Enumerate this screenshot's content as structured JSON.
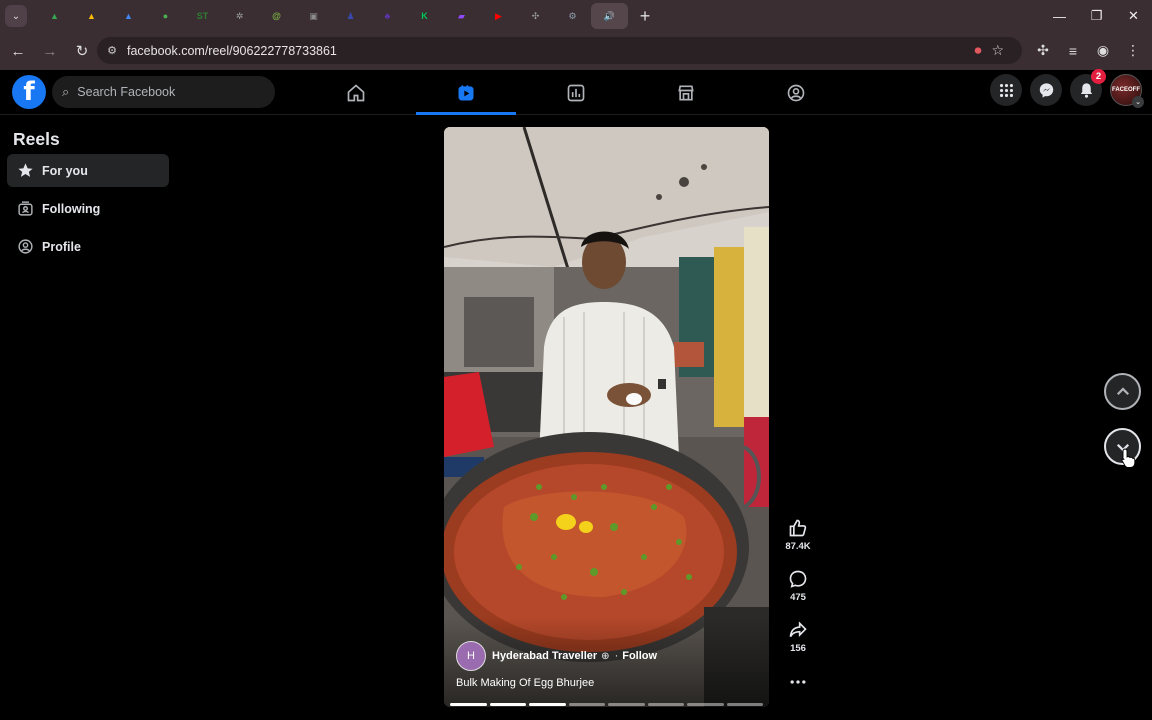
{
  "browser": {
    "url": "facebook.com/reel/906222778733861",
    "tab_favicons": [
      {
        "name": "drive-icon",
        "color": "#34a853",
        "glyph": "▲"
      },
      {
        "name": "drive-icon",
        "color": "#fbbc04",
        "glyph": "▲"
      },
      {
        "name": "drive-icon",
        "color": "#4285f4",
        "glyph": "▲"
      },
      {
        "name": "green-leaf-icon",
        "color": "#4caf50",
        "glyph": "●"
      },
      {
        "name": "st-icon",
        "color": "#2e7d32",
        "glyph": "ST"
      },
      {
        "name": "openai-icon",
        "color": "#9e9e9e",
        "glyph": "✲"
      },
      {
        "name": "at-icon",
        "color": "#7cb342",
        "glyph": "@"
      },
      {
        "name": "image-icon",
        "color": "#8d8d8d",
        "glyph": "▣"
      },
      {
        "name": "blue-icon",
        "color": "#3949ab",
        "glyph": "♟"
      },
      {
        "name": "purple-icon",
        "color": "#5e35b1",
        "glyph": "♣"
      },
      {
        "name": "k-icon",
        "color": "#00c853",
        "glyph": "K"
      },
      {
        "name": "twitch-icon",
        "color": "#9146ff",
        "glyph": "▰"
      },
      {
        "name": "youtube-icon",
        "color": "#ff0000",
        "glyph": "▶"
      },
      {
        "name": "puzzle-icon",
        "color": "#9e9e9e",
        "glyph": "✣"
      },
      {
        "name": "tool-icon",
        "color": "#90a4ae",
        "glyph": "⚙"
      },
      {
        "name": "audio-icon",
        "color": "#bbbbbb",
        "glyph": "🔊"
      }
    ]
  },
  "facebook": {
    "search_placeholder": "Search Facebook",
    "notification_count": "2",
    "profile_text": "FACEOFF"
  },
  "sidebar": {
    "title": "Reels",
    "items": [
      {
        "label": "For you"
      },
      {
        "label": "Following"
      },
      {
        "label": "Profile"
      }
    ]
  },
  "reel": {
    "author": "Hyderabad Traveller",
    "follow_label": "Follow",
    "separator": "·",
    "caption": "Bulk Making Of Egg Bhurjee",
    "likes": "87.4K",
    "comments": "475",
    "shares": "156",
    "progress_segments_done": 3,
    "progress_segments_total": 8
  },
  "colors": {
    "fb_blue": "#1877f2",
    "background": "#000000",
    "surface": "#242526",
    "badge_red": "#e41e3f"
  }
}
